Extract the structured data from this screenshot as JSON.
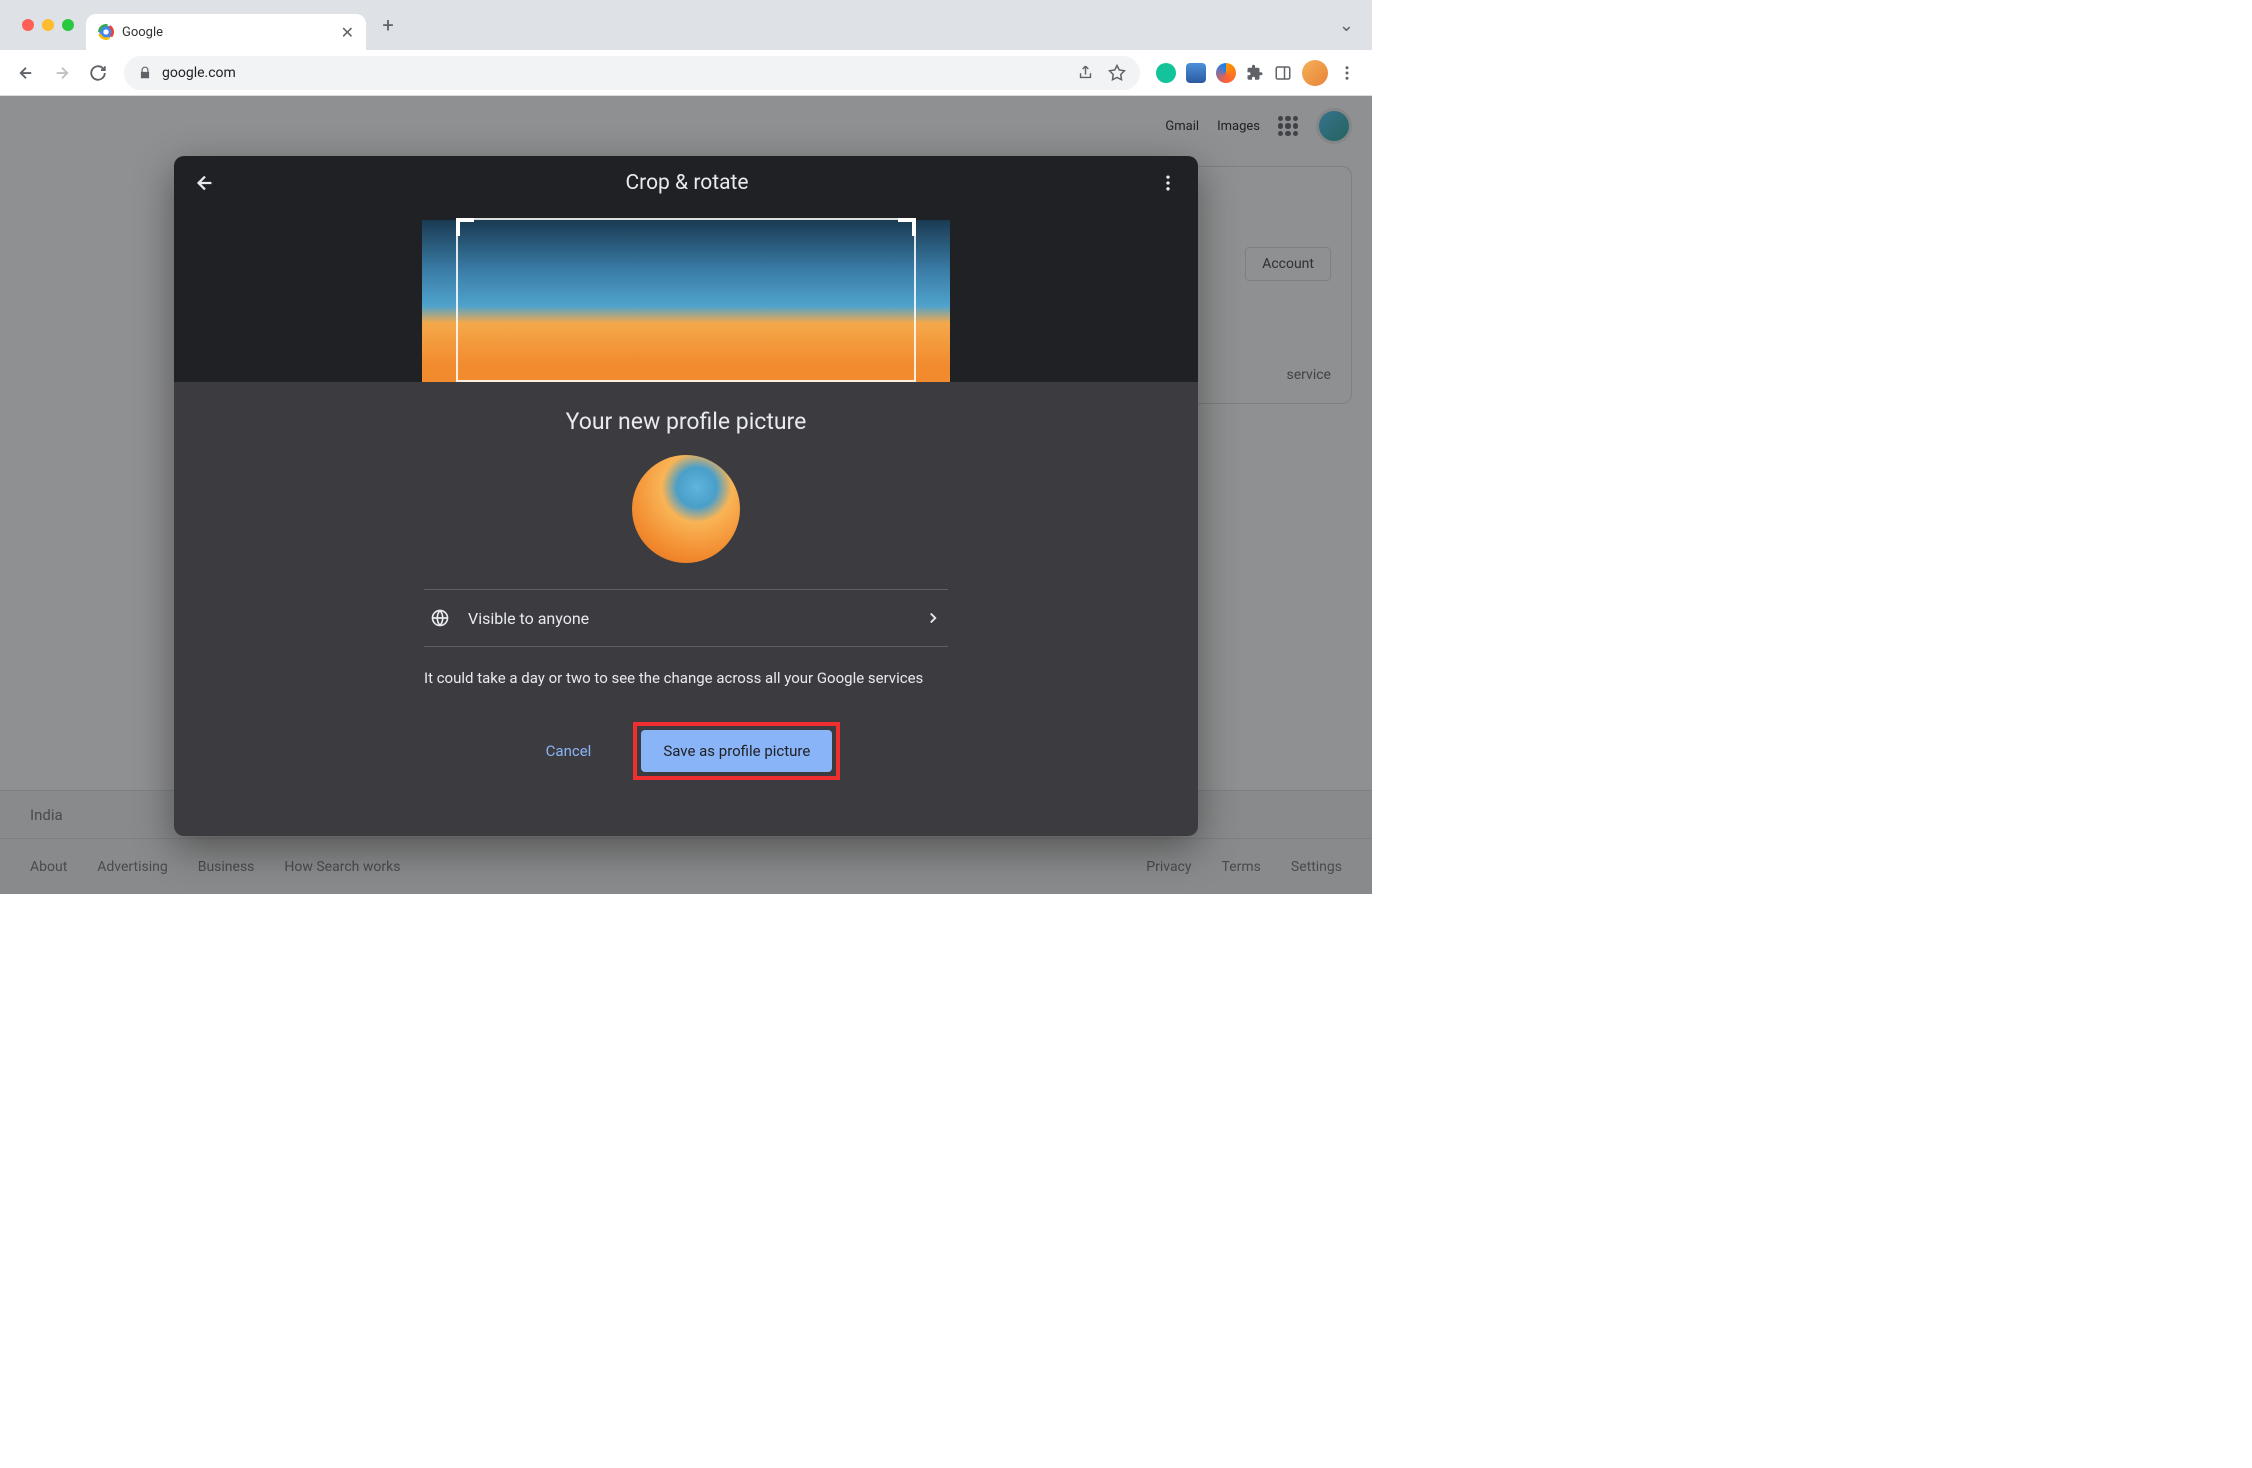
{
  "browser": {
    "tab_title": "Google",
    "url": "google.com"
  },
  "page": {
    "header": {
      "gmail": "Gmail",
      "images": "Images"
    },
    "account_button": "Account",
    "service_text": "service",
    "footer_country": "India",
    "footer_links_left": [
      "About",
      "Advertising",
      "Business",
      "How Search works"
    ],
    "footer_links_right": [
      "Privacy",
      "Terms",
      "Settings"
    ]
  },
  "dialog": {
    "crop_title": "Crop & rotate",
    "sheet_title": "Your new profile picture",
    "visibility_label": "Visible to anyone",
    "delay_notice": "It could take a day or two to see the change across all your Google services",
    "cancel_label": "Cancel",
    "save_label": "Save as profile picture"
  }
}
